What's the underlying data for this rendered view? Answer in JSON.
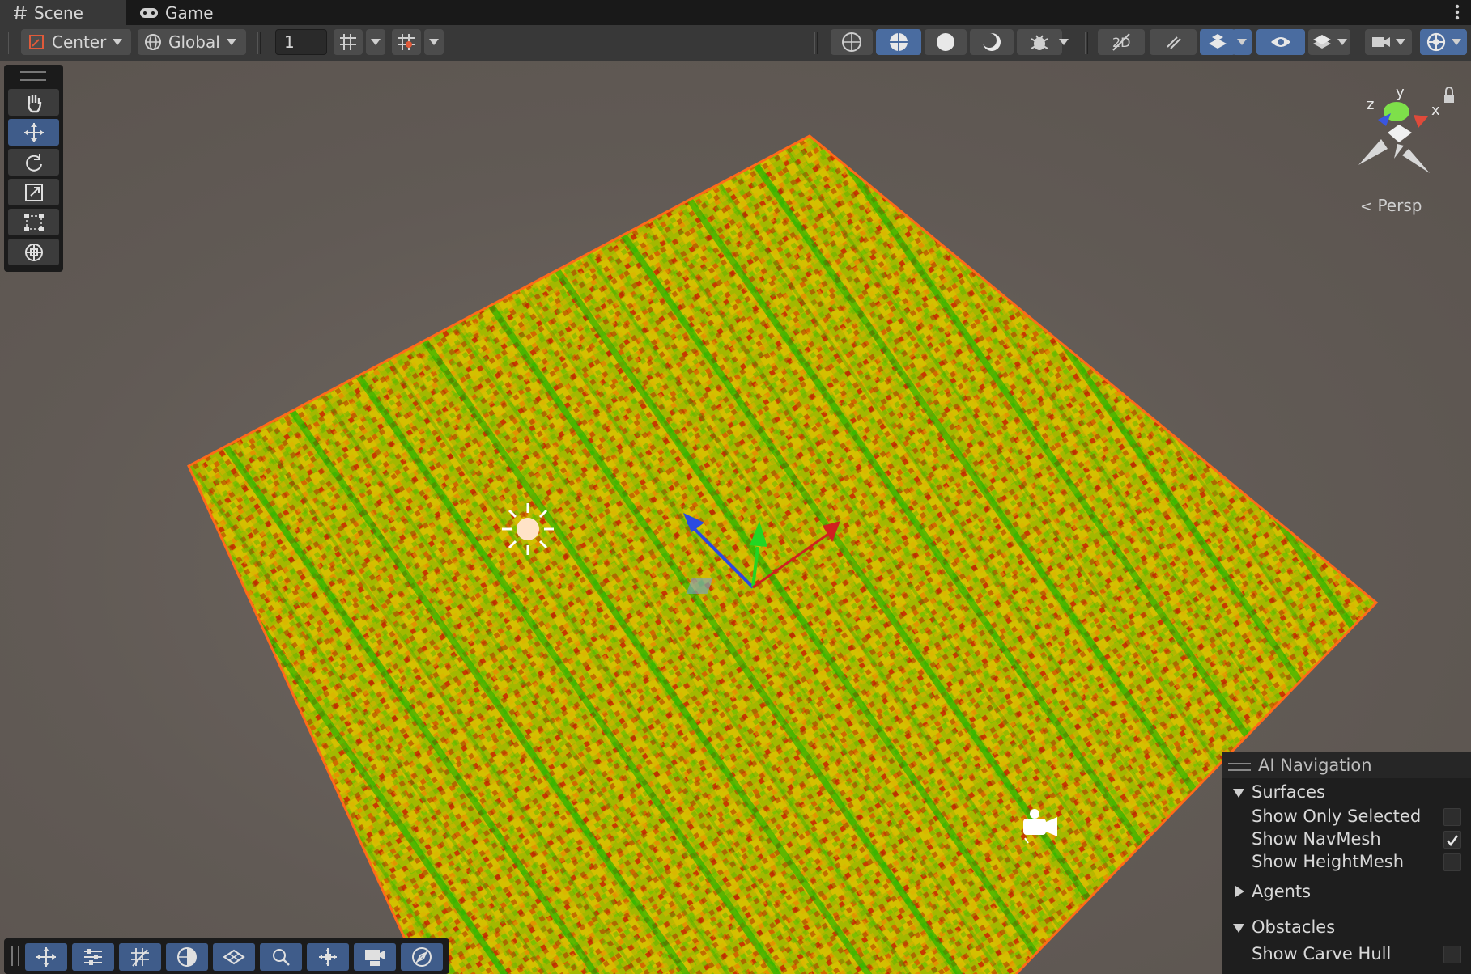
{
  "tabs": [
    {
      "label": "Scene",
      "icon": "hash-icon",
      "active": true
    },
    {
      "label": "Game",
      "icon": "gamepad-icon",
      "active": false
    }
  ],
  "toolbar": {
    "pivot_mode": "Center",
    "pivot_rotation": "Global",
    "grid_snap_value": "1"
  },
  "scene": {
    "projection_label": "Persp",
    "gizmo_axes": {
      "x": "x",
      "y": "y",
      "z": "z"
    }
  },
  "ai_navigation": {
    "title": "AI Navigation",
    "surfaces": {
      "label": "Surfaces",
      "expanded": true,
      "options": [
        {
          "label": "Show Only Selected",
          "checked": false
        },
        {
          "label": "Show NavMesh",
          "checked": true
        },
        {
          "label": "Show HeightMesh",
          "checked": false
        }
      ]
    },
    "agents": {
      "label": "Agents",
      "expanded": false
    },
    "obstacles": {
      "label": "Obstacles",
      "expanded": true,
      "options": [
        {
          "label": "Show Carve Hull",
          "checked": false
        }
      ]
    }
  },
  "colors": {
    "accent": "#4a6ca0",
    "selection_outline": "#ff6a1a",
    "background": "#5e5752"
  }
}
